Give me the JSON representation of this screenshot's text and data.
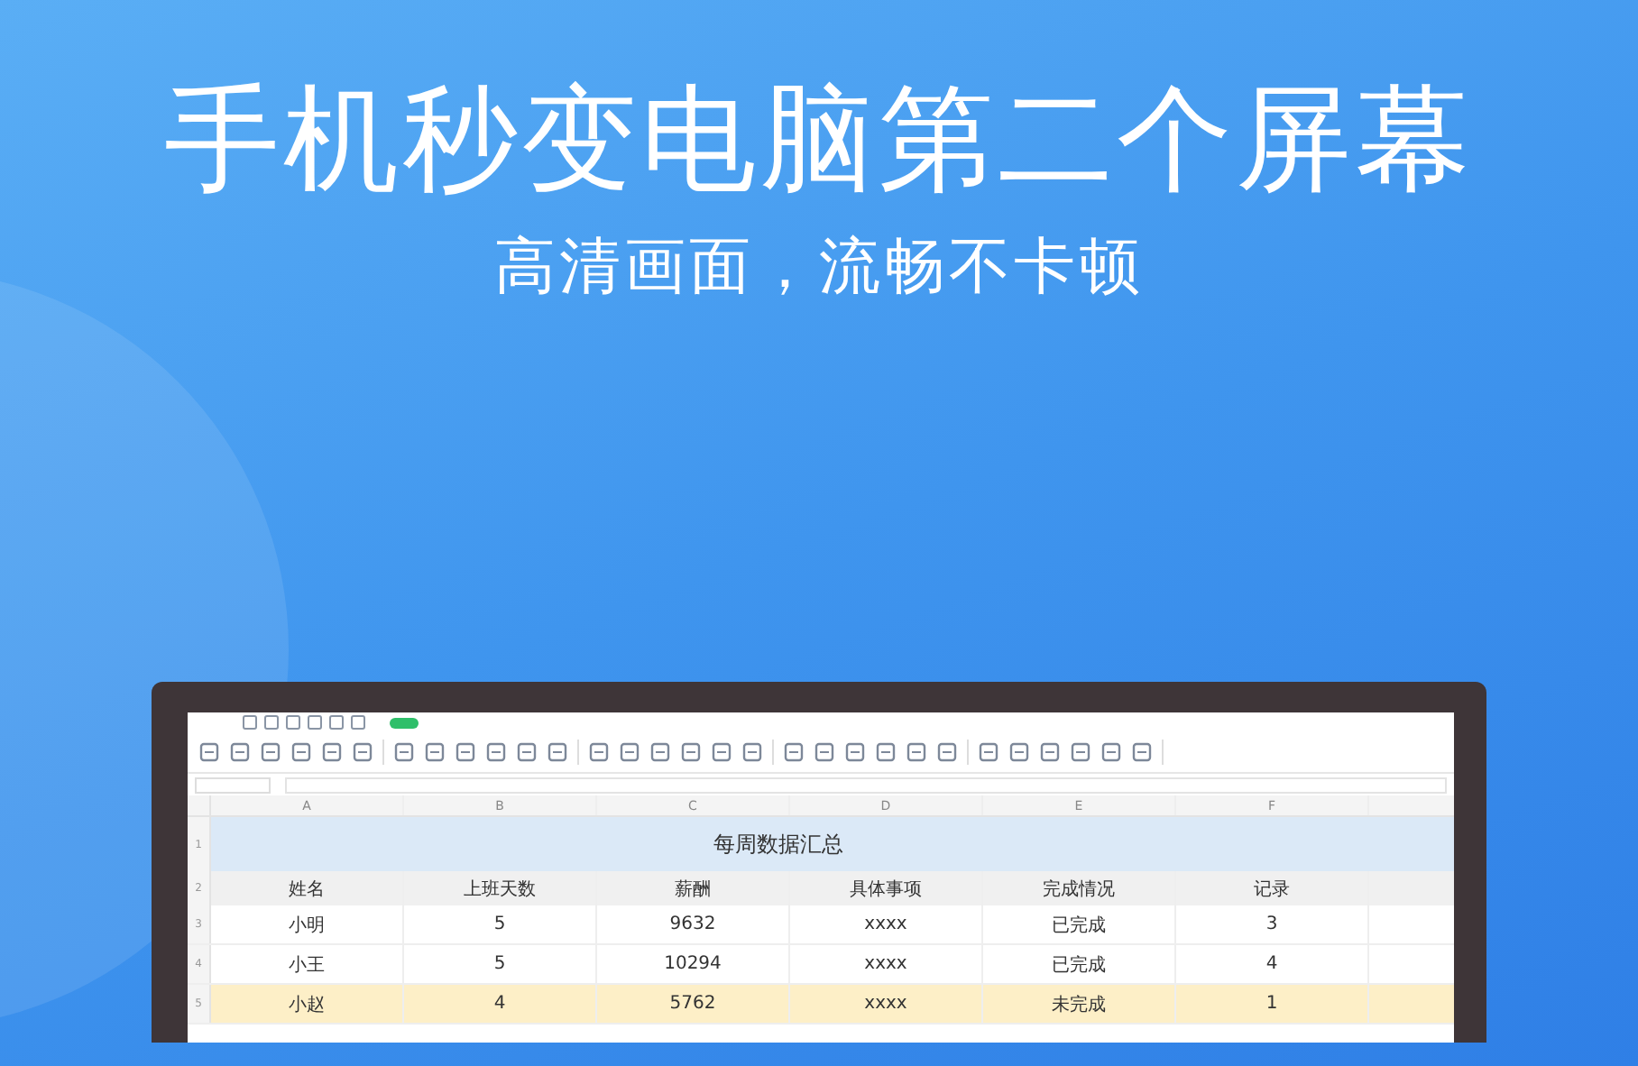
{
  "headline": "手机秒变电脑第二个屏幕",
  "subheadline": "高清画面，流畅不卡顿",
  "sheet": {
    "column_letters": [
      "A",
      "B",
      "C",
      "D",
      "E",
      "F"
    ],
    "title_row": {
      "number": "1",
      "title": "每周数据汇总"
    },
    "header_row": {
      "number": "2",
      "columns": [
        "姓名",
        "上班天数",
        "薪酬",
        "具体事项",
        "完成情况",
        "记录"
      ]
    },
    "rows": [
      {
        "number": "3",
        "highlighted": false,
        "cells": [
          "小明",
          "5",
          "9632",
          "xxxx",
          "已完成",
          "3"
        ]
      },
      {
        "number": "4",
        "highlighted": false,
        "cells": [
          "小王",
          "5",
          "10294",
          "xxxx",
          "已完成",
          "4"
        ]
      },
      {
        "number": "5",
        "highlighted": true,
        "cells": [
          "小赵",
          "4",
          "5762",
          "xxxx",
          "未完成",
          "1"
        ]
      }
    ]
  }
}
